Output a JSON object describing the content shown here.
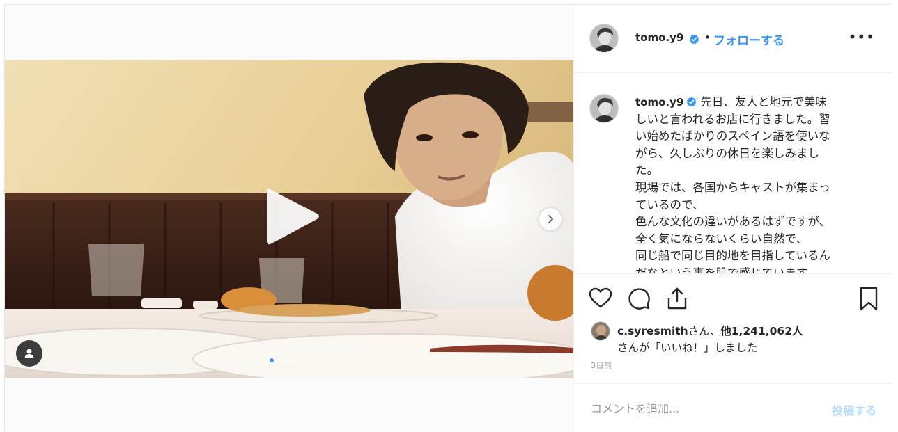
{
  "post": {
    "author": {
      "username": "tomo.y9",
      "verified_icon": "verified-badge-icon",
      "separator": "•",
      "follow_label": "フォローする",
      "more_label": "•••"
    },
    "media": {
      "type": "video",
      "play_icon": "play-icon",
      "next_icon": "chevron-right-icon",
      "user_tag_icon": "user-icon",
      "carousel_total": 4,
      "carousel_active": 1
    },
    "caption": {
      "username": "tomo.y9",
      "lines": [
        "先日、友人と地元で美味",
        "しいと言われるお店に行きました。習",
        "い始めたばかりのスペイン語を使いな",
        "がら、久しぶりの休日を楽しみまし",
        "た。",
        "現場では、各国からキャストが集まっ",
        "ているので、",
        "色んな文化の違いがあるはずですが、",
        "全く気にならないくらい自然で、",
        "同じ船で同じ目的地を目指しているん",
        "だなという事を肌で感じています。"
      ]
    },
    "actions": {
      "like_icon": "heart-icon",
      "comment_icon": "comment-bubble-icon",
      "share_icon": "share-icon",
      "save_icon": "bookmark-icon"
    },
    "likes": {
      "liker": "c.syresmith",
      "san1": "さん、",
      "others": "他1,241,062人",
      "line2": "さんが「いいね！」しました"
    },
    "timestamp": "3日前",
    "comment_box": {
      "placeholder": "コメントを追加...",
      "post_label": "投稿する"
    },
    "colors": {
      "link_blue": "#3897f0",
      "post_disabled": "#b3dbff",
      "border": "#efefef"
    }
  }
}
